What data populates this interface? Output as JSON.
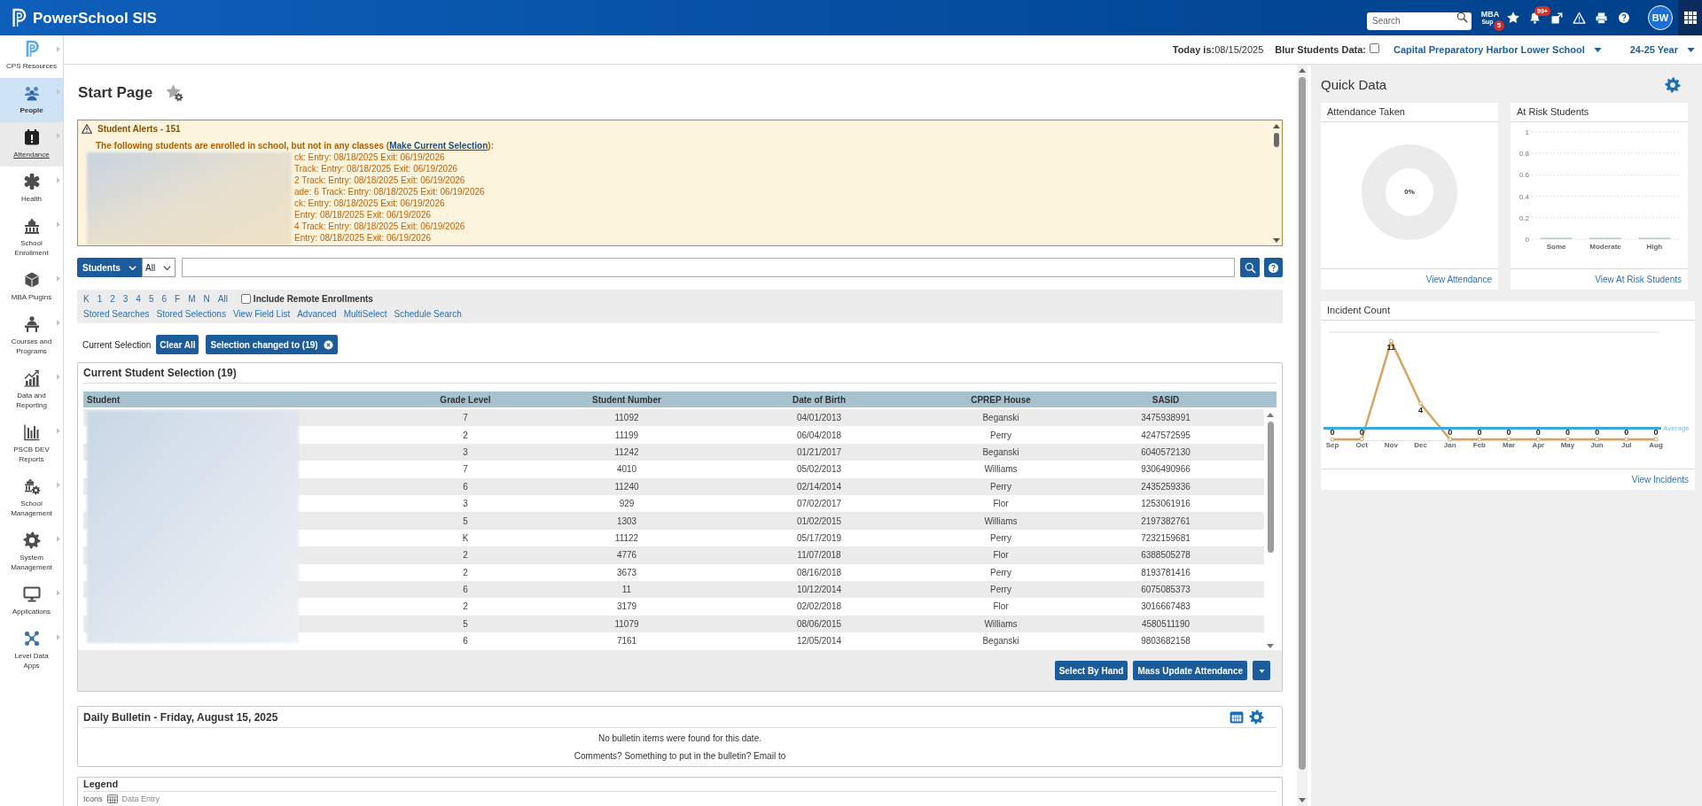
{
  "header": {
    "logo": "PowerSchool SIS",
    "search": {
      "placeholder": "Search"
    },
    "mba": {
      "line_1": "MBA",
      "line_2": "Sup",
      "badge": "5"
    },
    "notifications": {
      "badge": "99+"
    },
    "avatar": "BW"
  },
  "context_bar": {
    "today": "**Today is:**08/15/2025",
    "blur": {
      "label": "Blur Students Data:",
      "checked": false
    },
    "school": "Capital Preparatory Harbor Lower School",
    "year": "24-25 Year"
  },
  "sidebar": {
    "items": [
      {
        "label": "CPS Resources",
        "selected": false,
        "hovered": false
      },
      {
        "label": "People",
        "selected": true,
        "hovered": false
      },
      {
        "label": "Attendance",
        "selected": false,
        "hovered": true
      },
      {
        "label": "Health",
        "selected": false,
        "hovered": false
      },
      {
        "label": "School Enrollment",
        "selected": false,
        "hovered": false
      },
      {
        "label": "MBA Plugins",
        "selected": false,
        "hovered": false
      },
      {
        "label": "Courses and Programs",
        "selected": false,
        "hovered": false
      },
      {
        "label": "Data and Reporting",
        "selected": false,
        "hovered": false
      },
      {
        "label": "PSCB DEV Reports",
        "selected": false,
        "hovered": false
      },
      {
        "label": "School Management",
        "selected": false,
        "hovered": false
      },
      {
        "label": "System Management",
        "selected": false,
        "hovered": false
      },
      {
        "label": "Applications",
        "selected": false,
        "hovered": false
      },
      {
        "label": "Level Data Apps",
        "selected": false,
        "hovered": false
      }
    ]
  },
  "page": {
    "title": "Start Page"
  },
  "alerts": {
    "title": "Student Alerts - 151",
    "intro": "The following students are enrolled in school, but not in any classes (",
    "link": "Make Current Selection",
    "intro_end": "):",
    "lines": [
      "ck: Entry: 08/18/2025 Exit: 06/19/2026",
      "Track: Entry: 08/18/2025 Exit: 06/19/2026",
      "2 Track: Entry: 08/18/2025 Exit: 06/19/2026",
      "ade: 6 Track: Entry: 08/18/2025 Exit: 06/19/2026",
      "ck: Entry: 08/18/2025 Exit: 06/19/2026",
      "Entry: 08/18/2025 Exit: 06/19/2026",
      "4 Track: Entry: 08/18/2025 Exit: 06/19/2026",
      "Entry: 08/18/2025 Exit: 06/19/2026"
    ]
  },
  "search": {
    "scope": "Students",
    "filter": "All"
  },
  "filters": {
    "grades": [
      "K",
      "1",
      "2",
      "3",
      "4",
      "5",
      "6",
      "F",
      "M",
      "N",
      "All"
    ],
    "remote": {
      "label": "Include Remote Enrollments",
      "checked": false
    },
    "links": [
      "Stored Searches",
      "Stored Selections",
      "View Field List",
      "Advanced",
      "MultiSelect",
      "Schedule Search"
    ]
  },
  "current_selection": {
    "label": "Current Selection",
    "clear": "Clear All",
    "chip": "Selection changed to (19)"
  },
  "selection_table": {
    "title": "Current Student Selection (19)",
    "columns": [
      "Student",
      "Grade Level",
      "Student Number",
      "Date of Birth",
      "CPREP House",
      "SASID"
    ],
    "rows": [
      {
        "grade": "7",
        "number": "11092",
        "birth_date": "04/01/2013",
        "house": "Beganski",
        "sasid": "3475938991"
      },
      {
        "grade": "2",
        "number": "11199",
        "birth_date": "06/04/2018",
        "house": "Perry",
        "sasid": "4247572595"
      },
      {
        "grade": "3",
        "number": "11242",
        "birth_date": "01/21/2017",
        "house": "Beganski",
        "sasid": "6040572130"
      },
      {
        "grade": "7",
        "number": "4010",
        "birth_date": "05/02/2013",
        "house": "Williams",
        "sasid": "9306490966"
      },
      {
        "grade": "6",
        "number": "11240",
        "birth_date": "02/14/2014",
        "house": "Perry",
        "sasid": "2435259336"
      },
      {
        "grade": "3",
        "number": "929",
        "birth_date": "07/02/2017",
        "house": "Flor",
        "sasid": "1253061916"
      },
      {
        "grade": "5",
        "number": "1303",
        "birth_date": "01/02/2015",
        "house": "Williams",
        "sasid": "2197382761"
      },
      {
        "grade": "K",
        "number": "11122",
        "birth_date": "05/17/2019",
        "house": "Perry",
        "sasid": "7232159681"
      },
      {
        "grade": "2",
        "number": "4776",
        "birth_date": "11/07/2018",
        "house": "Flor",
        "sasid": "6388505278"
      },
      {
        "grade": "2",
        "number": "3673",
        "birth_date": "08/16/2018",
        "house": "Perry",
        "sasid": "8193781416"
      },
      {
        "grade": "6",
        "number": "11",
        "birth_date": "10/12/2014",
        "house": "Perry",
        "sasid": "6075085373"
      },
      {
        "grade": "2",
        "number": "3179",
        "birth_date": "02/02/2018",
        "house": "Flor",
        "sasid": "3016667483"
      },
      {
        "grade": "5",
        "number": "11079",
        "birth_date": "08/06/2015",
        "house": "Williams",
        "sasid": "4580511190"
      },
      {
        "grade": "6",
        "number": "7161",
        "birth_date": "12/05/2014",
        "house": "Beganski",
        "sasid": "9803682158"
      }
    ]
  },
  "actions": [
    "Select By Hand",
    "Mass Update Attendance"
  ],
  "bulletin": {
    "title": "Daily Bulletin - Friday, August 15, 2025",
    "empty": "No bulletin items were found for this date.",
    "comment": "Comments? Something to put in the bulletin? Email to"
  },
  "legend": {
    "title": "Legend",
    "icons_label": "Icons",
    "entries": [
      "Data Entry"
    ]
  },
  "quick_data": {
    "title": "Quick Data",
    "attendance": {
      "title": "Attendance Taken",
      "center_label": "0%",
      "link": "View Attendance"
    },
    "at_risk": {
      "title": "At Risk Students",
      "link": "View At Risk Students",
      "chart_data": {
        "type": "bar",
        "categories": [
          "Some",
          "Moderate",
          "High"
        ],
        "series": [
          {
            "color": "#a9cfc8",
            "values": [
              0,
              0,
              0
            ]
          }
        ],
        "ylim": [
          0,
          1
        ],
        "yticks": [
          0,
          0.2,
          0.4,
          0.6,
          0.8,
          1
        ],
        "grid": true
      }
    },
    "incidents": {
      "title": "Incident Count",
      "link": "View Incidents",
      "average_label": "Average",
      "chart_data": {
        "type": "line",
        "categories": [
          "Sep",
          "Oct",
          "Nov",
          "Dec",
          "Jan",
          "Feb",
          "Mar",
          "Apr",
          "May",
          "Jun",
          "Jul",
          "Aug"
        ],
        "series": [
          {
            "color": "#d9a25f",
            "values": [
              0,
              0,
              11,
              4,
              0,
              0,
              0,
              0,
              0,
              0,
              0,
              0
            ],
            "marker": true
          }
        ],
        "ylim": [
          0,
          12
        ],
        "data_labels": true
      }
    }
  }
}
